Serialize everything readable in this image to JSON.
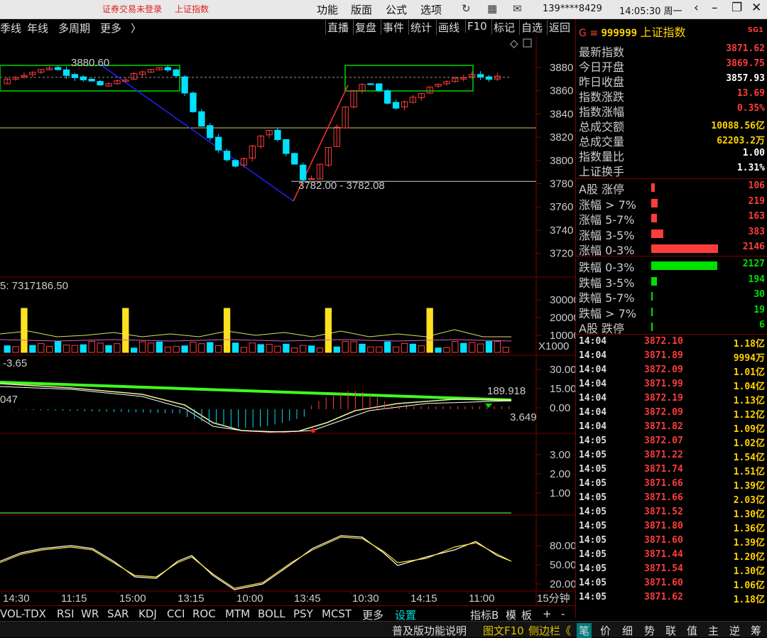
{
  "titlebar": {
    "login_status": "证券交易未登录",
    "window_title": "上证指数",
    "menu": [
      "功能",
      "版面",
      "公式",
      "选项"
    ],
    "account": "139****8429",
    "clock": "14:05:30 周一"
  },
  "toolbar": {
    "period_items": [
      "季线",
      "年线",
      "多周期",
      "更多"
    ],
    "right_items": [
      "直播",
      "复盘",
      "事件",
      "统计",
      "画线",
      "F10",
      "标记",
      "自选",
      "返回"
    ]
  },
  "chart": {
    "price_axis": [
      "3880",
      "3860",
      "3840",
      "3820",
      "3800",
      "3780",
      "3760",
      "3740",
      "3720"
    ],
    "high_label": "3880.60",
    "low_label": "3782.00 - 3782.08",
    "vol_info": "5: 7317186.50",
    "vol_axis": [
      "30000",
      "20000",
      "10000"
    ],
    "vol_unit": "X1000",
    "macd_info": "-3.65",
    "macd_axis": [
      "30.00",
      "15.00",
      "0.00"
    ],
    "macd_left_value": "047",
    "macd_value1": "189.918",
    "macd_value2": "3.649",
    "ind3_axis": [
      "3.00",
      "2.00",
      "1.00"
    ],
    "kdj_axis": [
      "80.00",
      "50.00",
      "20.00"
    ],
    "time_axis": [
      "14:30",
      "11:15",
      "15:00",
      "13:15",
      "10:00",
      "13:45",
      "10:30",
      "14:15",
      "11:00"
    ],
    "period_label": "15分钟"
  },
  "indicator_tabs": [
    "VOL-TDX",
    "RSI",
    "WR",
    "SAR",
    "KDJ",
    "CCI",
    "ROC",
    "MTM",
    "BOLL",
    "PSY",
    "MCST",
    "更多",
    "设置"
  ],
  "indicator_tabs_right": [
    "指标B",
    "模",
    "板",
    "+",
    "-"
  ],
  "bottom_bar": {
    "left": "普及版功能说明",
    "link": "图文F10",
    "sidebar": "侧边栏《",
    "tabs": [
      "笔",
      "价",
      "细",
      "势",
      "联",
      "值",
      "主",
      "逆",
      "筹"
    ]
  },
  "quote": {
    "header_g": "G",
    "code": "999999",
    "name": "上证指数",
    "badge": "SG1",
    "rows": [
      {
        "label": "最新指数",
        "value": "3871.62",
        "color": "red"
      },
      {
        "label": "今日开盘",
        "value": "3869.75",
        "color": "red"
      },
      {
        "label": "昨日收盘",
        "value": "3857.93",
        "color": "white"
      },
      {
        "label": "指数涨跌",
        "value": "13.69",
        "color": "red"
      },
      {
        "label": "指数涨幅",
        "value": "0.35%",
        "color": "red"
      },
      {
        "label": "总成交额",
        "value": "10088.56亿",
        "color": "yellow"
      },
      {
        "label": "总成交量",
        "value": "62203.2万",
        "color": "yellow"
      },
      {
        "label": "指数量比",
        "value": "1.00",
        "color": "white"
      },
      {
        "label": "上证换手",
        "value": "1.31%",
        "color": "white"
      }
    ]
  },
  "breadth_up": [
    {
      "label": "A股 涨停",
      "value": "106",
      "frac": 0.05
    },
    {
      "label": "涨幅 > 7%",
      "value": "219",
      "frac": 0.1
    },
    {
      "label": "涨幅 5-7%",
      "value": "163",
      "frac": 0.08
    },
    {
      "label": "涨幅 3-5%",
      "value": "383",
      "frac": 0.18
    },
    {
      "label": "涨幅 0-3%",
      "value": "2146",
      "frac": 1.0
    }
  ],
  "breadth_down": [
    {
      "label": "跌幅 0-3%",
      "value": "2127",
      "frac": 0.99
    },
    {
      "label": "跌幅 3-5%",
      "value": "194",
      "frac": 0.09
    },
    {
      "label": "跌幅 5-7%",
      "value": "30",
      "frac": 0.015
    },
    {
      "label": "跌幅 > 7%",
      "value": "19",
      "frac": 0.01
    },
    {
      "label": "A股 跌停",
      "value": "6",
      "frac": 0.005
    }
  ],
  "ticks": [
    {
      "time": "14:04",
      "price": "3872.10",
      "vol": "1.18亿"
    },
    {
      "time": "14:04",
      "price": "3871.89",
      "vol": "9994万"
    },
    {
      "time": "14:04",
      "price": "3872.09",
      "vol": "1.01亿"
    },
    {
      "time": "14:04",
      "price": "3871.99",
      "vol": "1.04亿"
    },
    {
      "time": "14:04",
      "price": "3872.19",
      "vol": "1.13亿"
    },
    {
      "time": "14:04",
      "price": "3872.09",
      "vol": "1.12亿"
    },
    {
      "time": "14:04",
      "price": "3871.82",
      "vol": "1.09亿"
    },
    {
      "time": "14:05",
      "price": "3872.07",
      "vol": "1.02亿"
    },
    {
      "time": "14:05",
      "price": "3871.22",
      "vol": "1.54亿"
    },
    {
      "time": "14:05",
      "price": "3871.74",
      "vol": "1.51亿"
    },
    {
      "time": "14:05",
      "price": "3871.66",
      "vol": "1.39亿"
    },
    {
      "time": "14:05",
      "price": "3871.66",
      "vol": "2.03亿"
    },
    {
      "time": "14:05",
      "price": "3871.52",
      "vol": "1.30亿"
    },
    {
      "time": "14:05",
      "price": "3871.80",
      "vol": "1.36亿"
    },
    {
      "time": "14:05",
      "price": "3871.60",
      "vol": "1.39亿"
    },
    {
      "time": "14:05",
      "price": "3871.44",
      "vol": "1.20亿"
    },
    {
      "time": "14:05",
      "price": "3871.54",
      "vol": "1.30亿"
    },
    {
      "time": "14:05",
      "price": "3871.60",
      "vol": "1.06亿"
    },
    {
      "time": "14:05",
      "price": "3871.62",
      "vol": "1.18亿"
    }
  ],
  "colors": {
    "up": "#ff3c3c",
    "down": "#00e0ff",
    "box": "#00a000",
    "grid": "#7a0000"
  }
}
